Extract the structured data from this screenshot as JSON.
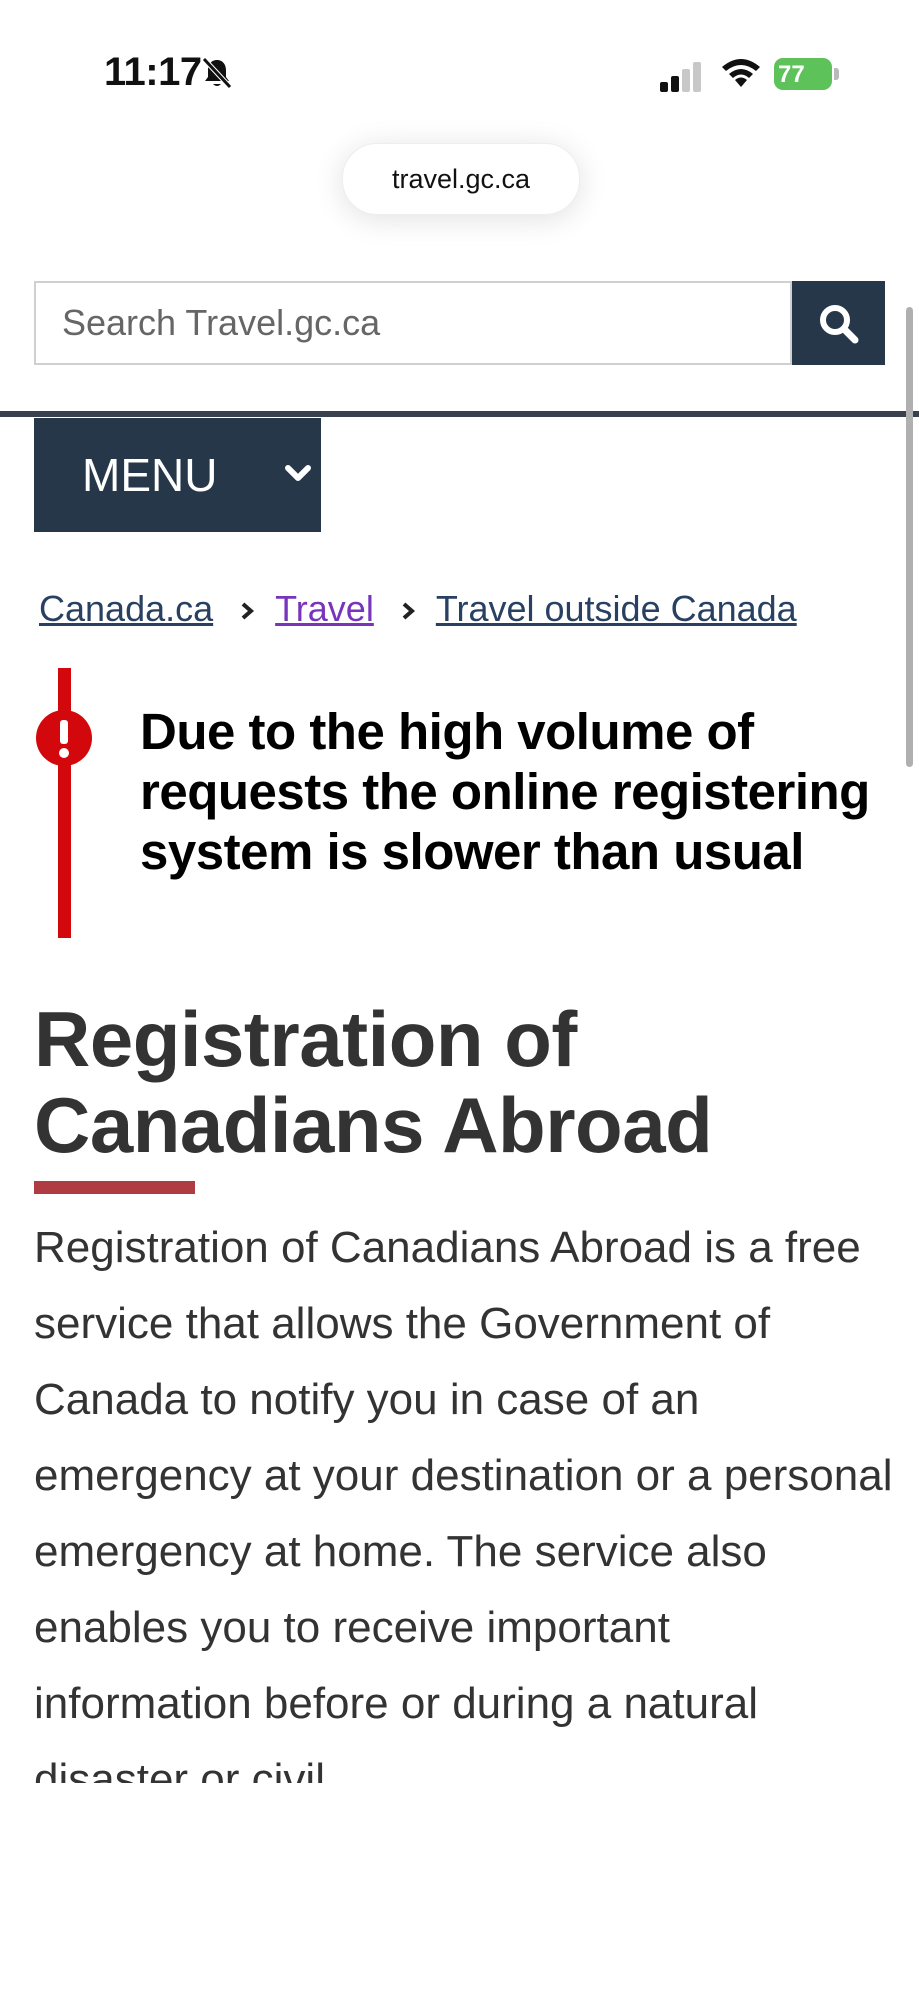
{
  "status_bar": {
    "time": "11:17",
    "battery": "77"
  },
  "browser": {
    "url": "travel.gc.ca"
  },
  "search": {
    "placeholder": "Search Travel.gc.ca"
  },
  "menu": {
    "label": "MENU"
  },
  "breadcrumb": {
    "items": [
      "Canada.ca",
      "Travel",
      "Travel outside Canada"
    ]
  },
  "alert": {
    "text": "Due to the high volume of requests the online registering system is slower than usual"
  },
  "main": {
    "title": "Registration of Canadians Abroad",
    "intro": "Registration of Canadians Abroad is a free service that allows the Government of Canada to notify you in case of an emergency at your destination or a personal emergency at home. The service also enables you to receive important information before or during a natural disaster or civil"
  },
  "colors": {
    "nav_dark": "#26374a",
    "alert_red": "#d3080c",
    "title_underline": "#af3c43",
    "link": "#284162",
    "visited_link": "#7834bc"
  }
}
